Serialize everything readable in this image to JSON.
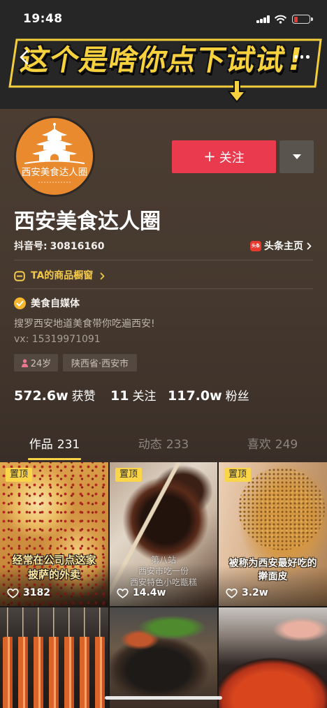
{
  "status_bar": {
    "time": "19:48",
    "signal_icon": "signal-icon",
    "wifi_icon": "wifi-icon",
    "battery_icon": "battery-low-icon",
    "battery_color": "#E53935"
  },
  "header": {
    "back_icon": "chevron-left-icon",
    "more_icon": "more-dots-icon",
    "banner_text": "这个是啥你点下试试",
    "banner_exclaim": "!",
    "banner_color": "#F7D23E"
  },
  "profile": {
    "avatar_text": "西安美食达人圈",
    "avatar_color": "#E98A2F",
    "name": "西安美食达人圈",
    "id_label": "抖音号:",
    "id_value": "30816160",
    "toutiao_badge": "头条",
    "toutiao_link": "头条主页",
    "shop_window": "TA的商品橱窗",
    "verified_label": "美食自媒体",
    "bio_line1": "搜罗西安地道美食带你吃遍西安!",
    "bio_line2": "vx: 15319971091",
    "tags": [
      {
        "icon": "female-icon",
        "label": "24岁"
      },
      {
        "label": "陕西省·西安市"
      }
    ]
  },
  "actions": {
    "follow_plus": "+",
    "follow_label": "关注",
    "follow_color": "#EA3A4E",
    "dropdown_icon": "triangle-down-icon"
  },
  "stats": [
    {
      "value": "572.6w",
      "label": "获赞"
    },
    {
      "value": "11",
      "label": "关注"
    },
    {
      "value": "117.0w",
      "label": "粉丝"
    }
  ],
  "tabs": [
    {
      "label": "作品",
      "count": "231",
      "active": true
    },
    {
      "label": "动态",
      "count": "233",
      "active": false
    },
    {
      "label": "喜欢",
      "count": "249",
      "active": false
    }
  ],
  "posts": [
    {
      "pinned": true,
      "badge": "置顶",
      "likes": "3182",
      "caption": [
        "经常在公司点这家",
        "披萨的外卖"
      ]
    },
    {
      "pinned": true,
      "badge": "置顶",
      "likes": "14.4w",
      "caption": [
        "第八站",
        "西安市吃一份",
        "西安特色小吃甑糕"
      ]
    },
    {
      "pinned": true,
      "badge": "置顶",
      "likes": "3.2w",
      "caption": [
        "被称为西安最好吃的",
        "擀面皮"
      ]
    },
    {
      "pinned": false
    },
    {
      "pinned": false
    },
    {
      "pinned": false
    }
  ],
  "accent_colors": {
    "tab_indicator": "#F8D347",
    "pinned_badge": "#FAD54A",
    "shop_link": "#F2C94C"
  }
}
